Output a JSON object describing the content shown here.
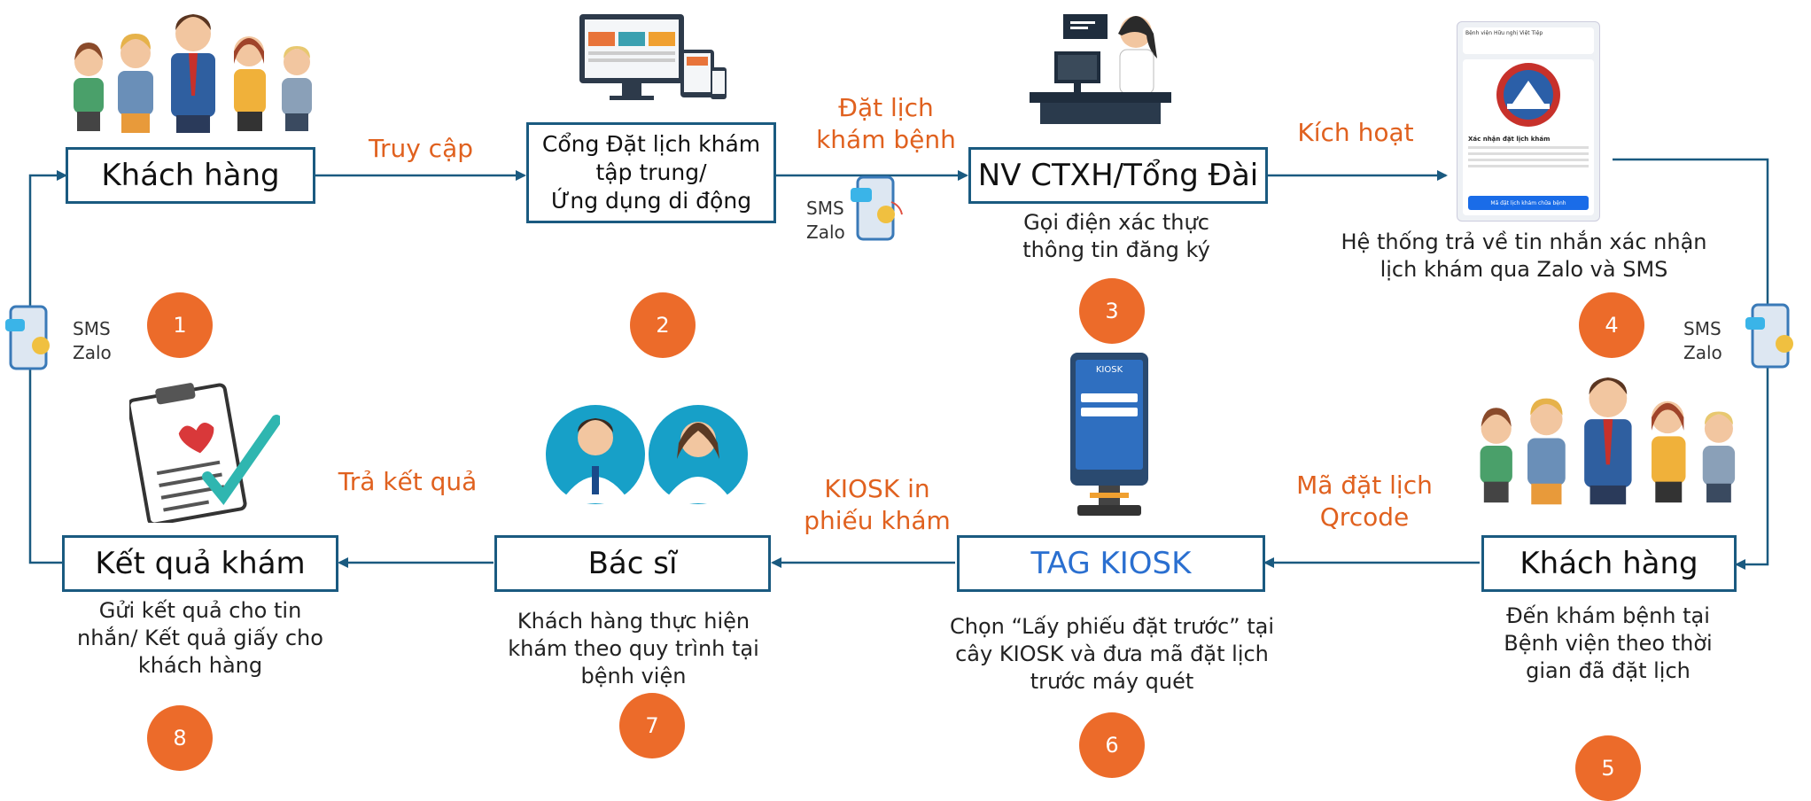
{
  "nodes": {
    "n1": {
      "label": "Khách hàng"
    },
    "n2": {
      "line1": "Cổng Đặt lịch khám",
      "line2": "tập trung/",
      "line3": "Ứng dụng di động"
    },
    "n3": {
      "label": "NV CTXH/Tổng Đài"
    },
    "n5": {
      "label": "Khách hàng"
    },
    "n6": {
      "label": "TAG KIOSK"
    },
    "n7": {
      "label": "Bác sĩ"
    },
    "n8": {
      "label": "Kết quả khám"
    }
  },
  "edges": {
    "e12": "Truy cập",
    "e23": {
      "line1": "Đặt lịch",
      "line2": "khám bệnh"
    },
    "e34": "Kích hoạt",
    "e56": {
      "line1": "Mã đặt lịch",
      "line2": "Qrcode"
    },
    "e67": {
      "line1": "KIOSK in",
      "line2": "phiếu khám"
    },
    "e78": "Trả kết quả"
  },
  "descriptions": {
    "d3": {
      "line1": "Gọi điện xác thực",
      "line2": "thông tin đăng ký"
    },
    "d4": {
      "line1": "Hệ thống trả về tin nhắn xác nhận",
      "line2": "lịch khám qua Zalo và SMS"
    },
    "d5": {
      "line1": "Đến khám bệnh tại",
      "line2": "Bệnh viện theo thời",
      "line3": "gian đã đặt lịch"
    },
    "d6": {
      "line1": "Chọn “Lấy phiếu đặt trước” tại",
      "line2": "cây KIOSK và đưa mã đặt lịch",
      "line3": "trước máy quét"
    },
    "d7": {
      "line1": "Khách hàng thực hiện",
      "line2": "khám theo quy trình tại",
      "line3": "bệnh viện"
    },
    "d8": {
      "line1": "Gửi kết quả cho tin",
      "line2": "nhắn/ Kết quả giấy cho",
      "line3": "khách hàng"
    }
  },
  "steps": [
    "1",
    "2",
    "3",
    "4",
    "5",
    "6",
    "7",
    "8"
  ],
  "sms_labels": {
    "sms": "SMS",
    "zalo": "Zalo"
  },
  "confirm_card": {
    "hospital": "Bệnh viện Hữu nghị Việt Tiệp",
    "seal_text": "VIET TIEP HOSPITAL",
    "title": "Xác nhận đặt lịch khám",
    "button": "Mã đặt lịch khám chữa bệnh"
  },
  "kiosk_screen": {
    "title": "KIOSK"
  },
  "colors": {
    "accent": "#e0611f",
    "line": "#1a5a80",
    "step": "#ec6b2a",
    "kiosk_text": "#2a6fd0"
  },
  "icons": [
    "people-group-icon",
    "devices-icon",
    "receptionist-icon",
    "phone-sms-icon",
    "doctors-icon",
    "clipboard-result-icon",
    "kiosk-icon",
    "confirmation-card-icon"
  ]
}
